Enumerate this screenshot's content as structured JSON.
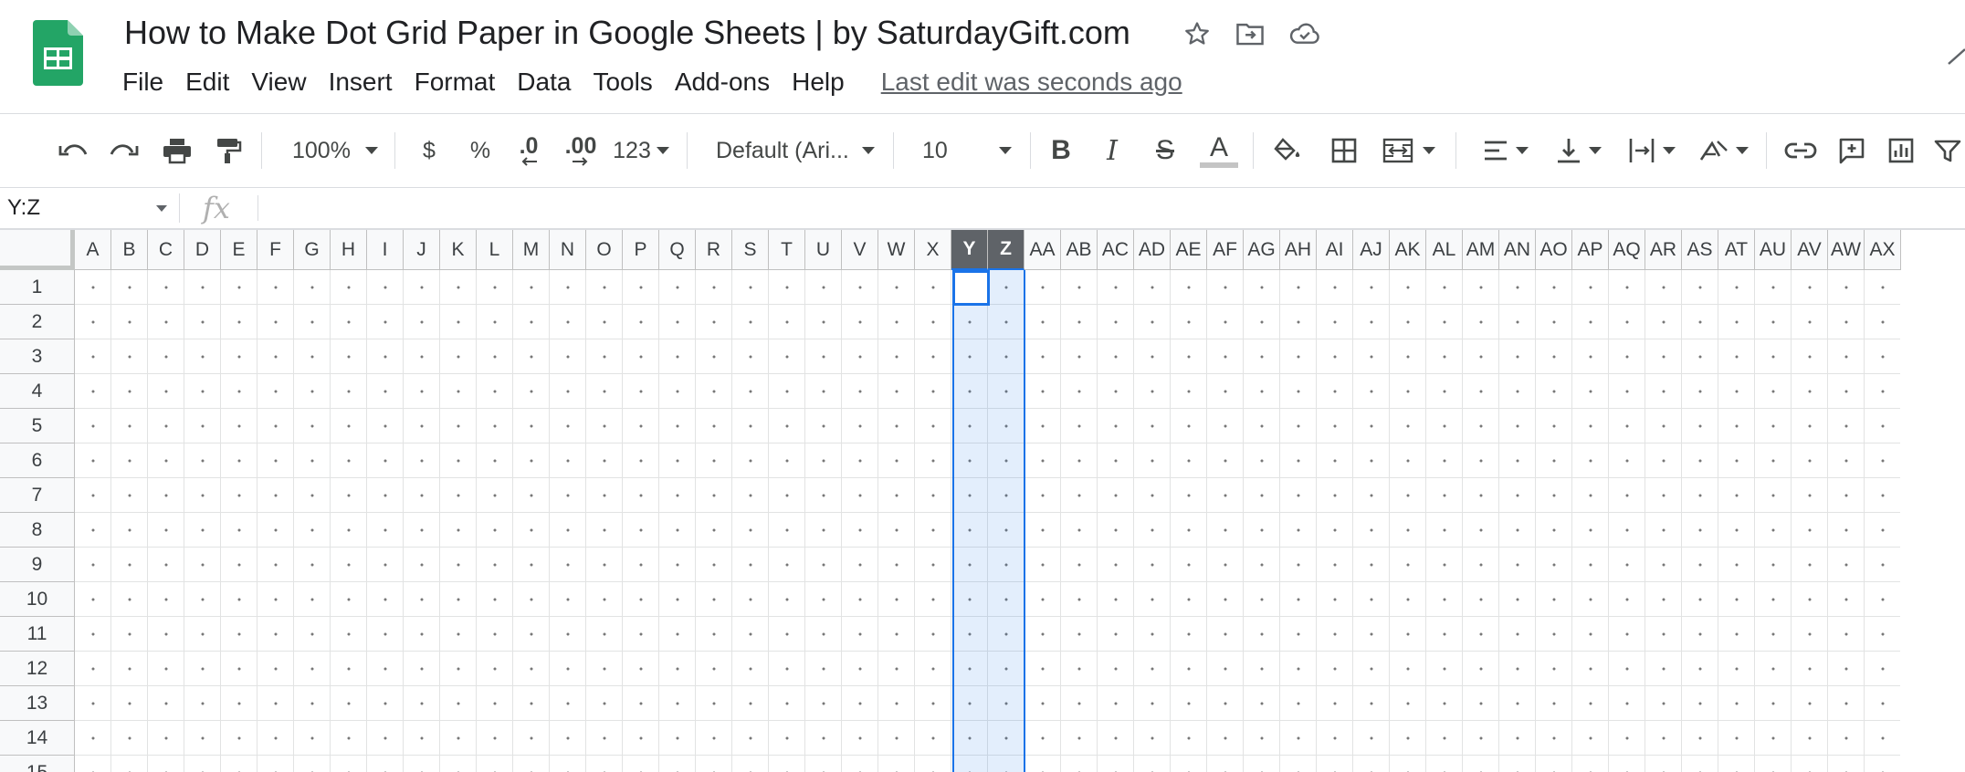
{
  "document": {
    "title": "How to Make Dot Grid Paper in Google Sheets | by SaturdayGift.com",
    "last_edit": "Last edit was seconds ago"
  },
  "menu": [
    "File",
    "Edit",
    "View",
    "Insert",
    "Format",
    "Data",
    "Tools",
    "Add-ons",
    "Help"
  ],
  "toolbar": {
    "zoom": "100%",
    "currency": "$",
    "percent": "%",
    "decrease_decimal": ".0",
    "increase_decimal": ".00",
    "more_formats": "123",
    "font": "Default (Ari...",
    "font_size": "10",
    "bold": "B",
    "italic": "I",
    "strikethrough": "S",
    "text_color": "A",
    "text_color_swatch": "#c4c4c4"
  },
  "formula_bar": {
    "name_box": "Y:Z",
    "fx": "fx",
    "value": ""
  },
  "grid": {
    "columns": [
      "A",
      "B",
      "C",
      "D",
      "E",
      "F",
      "G",
      "H",
      "I",
      "J",
      "K",
      "L",
      "M",
      "N",
      "O",
      "P",
      "Q",
      "R",
      "S",
      "T",
      "U",
      "V",
      "W",
      "X",
      "Y",
      "Z",
      "AA",
      "AB",
      "AC",
      "AD",
      "AE",
      "AF",
      "AG",
      "AH",
      "AI",
      "AJ",
      "AK",
      "AL",
      "AM",
      "AN",
      "AO",
      "AP",
      "AQ",
      "AR",
      "AS",
      "AT",
      "AU",
      "AV",
      "AW",
      "AX"
    ],
    "rows": [
      "1",
      "2",
      "3",
      "4",
      "5",
      "6",
      "7",
      "8",
      "9",
      "10",
      "11",
      "12",
      "13",
      "14",
      "15"
    ],
    "selected_columns": [
      "Y",
      "Z"
    ],
    "active_cell": "Y1",
    "accent_color": "#1a73e8"
  },
  "icons": {
    "app": "google-sheets-logo",
    "star": "star-icon",
    "move": "move-to-folder-icon",
    "saved": "cloud-saved-icon"
  }
}
